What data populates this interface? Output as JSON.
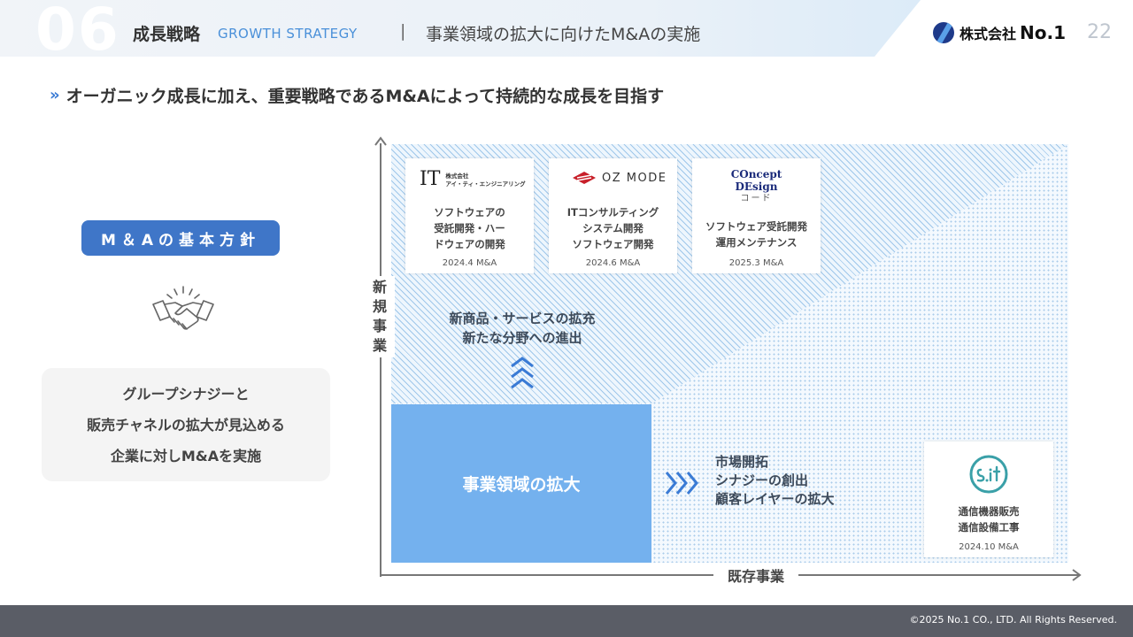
{
  "header": {
    "section_number": "06",
    "section_title": "成長戦略",
    "section_title_en": "GROWTH STRATEGY",
    "separator": "|",
    "subtitle": "事業領域の拡大に向けたM&Aの実施",
    "logo_jp": "株式会社",
    "logo_en": "No.1",
    "page_number": "22"
  },
  "headline": {
    "icon": "»",
    "text": "オーガニック成長に加え、重要戦略であるM&Aによって持続的な成長を目指す"
  },
  "policy": {
    "badge": "M＆Aの基本方針",
    "lines": [
      "グループシナジーと",
      "販売チャネルの拡大が見込める",
      "企業に対しM&Aを実施"
    ]
  },
  "matrix": {
    "y_axis_label": [
      "新",
      "規",
      "事",
      "業"
    ],
    "x_axis_label": "既存事業",
    "core_label": "事業領域の拡大",
    "new_business_text": [
      "新商品・サービスの拡充",
      "新たな分野への進出"
    ],
    "expansion_text": [
      "市場開拓",
      "シナジーの創出",
      "顧客レイヤーの拡大"
    ],
    "colors": {
      "core": "#74b1ee",
      "accent": "#3f76c8",
      "chevron": "#3a7bd5"
    }
  },
  "cards": [
    {
      "logo_mark": "IT",
      "logo_line1": "株式会社",
      "logo_line2": "アイ・ティ・エンジニアリング",
      "desc": [
        "ソフトウェアの",
        "受託開発・ハー",
        "ドウェアの開発"
      ],
      "date": "2024.4 M&A"
    },
    {
      "logo_text": "OZ MODE",
      "desc": [
        "ITコンサルティング",
        "システム開発",
        "ソフトウェア開発"
      ],
      "date": "2024.6 M&A"
    },
    {
      "logo_line1": "COncept",
      "logo_line2": "DEsign",
      "logo_kana": "コード",
      "desc": [
        "ソフトウェア受託開発",
        "運用メンテナンス"
      ],
      "date": "2025.3 M&A"
    },
    {
      "logo_text": "S.i.t",
      "desc": [
        "通信機器販売",
        "通信設備工事"
      ],
      "date": "2024.10 M&A"
    }
  ],
  "footer": {
    "copyright": "©2025 No.1 CO., LTD. All Rights Reserved."
  }
}
